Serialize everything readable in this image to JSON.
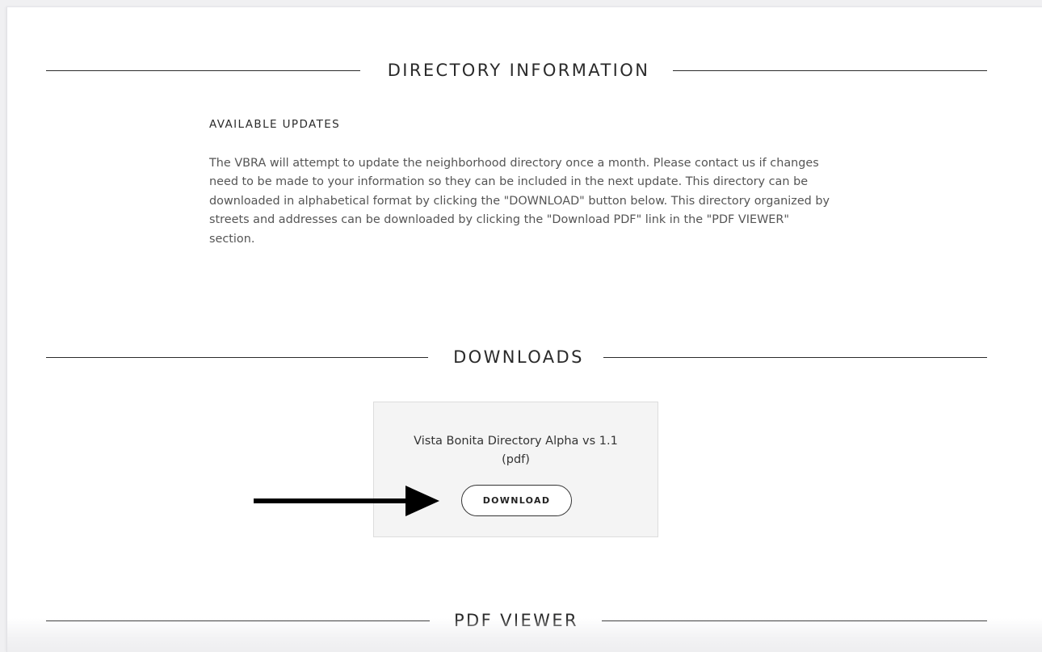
{
  "sections": {
    "directory_info": {
      "title": "DIRECTORY INFORMATION"
    },
    "downloads": {
      "title": "DOWNLOADS"
    },
    "pdf_viewer": {
      "title": "PDF VIEWER"
    }
  },
  "directory_info": {
    "subheading": "AVAILABLE UPDATES",
    "body": "The VBRA will attempt to update the neighborhood directory once a month. Please contact us if changes need to be made to your information so they can be included in the next update. This directory can be downloaded in alphabetical format by clicking the \"DOWNLOAD\" button below. This directory organized by streets and addresses can be downloaded by clicking the \"Download PDF\" link in the \"PDF VIEWER\" section."
  },
  "download_card": {
    "title": "Vista Bonita Directory Alpha vs 1.1 (pdf)",
    "button_label": "DOWNLOAD"
  },
  "icons": {
    "annotation_arrow": "right-arrow-icon"
  },
  "colors": {
    "rule": "#2b2b2b",
    "card_background": "#f4f4f4",
    "body_text": "#555555",
    "arrow": "#000000"
  }
}
